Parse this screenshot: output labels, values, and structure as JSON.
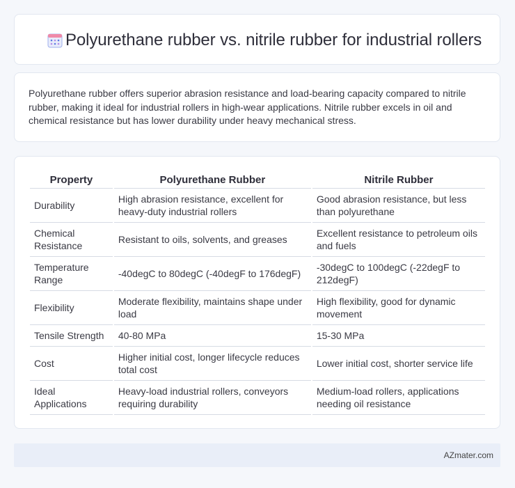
{
  "header": {
    "title": "Polyurethane rubber vs. nitrile rubber for industrial rollers",
    "icon": "calendar-icon"
  },
  "intro": {
    "text": "Polyurethane rubber offers superior abrasion resistance and load-bearing capacity compared to nitrile rubber, making it ideal for industrial rollers in high-wear applications. Nitrile rubber excels in oil and chemical resistance but has lower durability under heavy mechanical stress."
  },
  "table": {
    "headers": [
      "Property",
      "Polyurethane Rubber",
      "Nitrile Rubber"
    ],
    "rows": [
      [
        "Durability",
        "High abrasion resistance, excellent for heavy-duty industrial rollers",
        "Good abrasion resistance, but less than polyurethane"
      ],
      [
        "Chemical Resistance",
        "Resistant to oils, solvents, and greases",
        "Excellent resistance to petroleum oils and fuels"
      ],
      [
        "Temperature Range",
        "-40degC to 80degC (-40degF to 176degF)",
        "-30degC to 100degC (-22degF to 212degF)"
      ],
      [
        "Flexibility",
        "Moderate flexibility, maintains shape under load",
        "High flexibility, good for dynamic movement"
      ],
      [
        "Tensile Strength",
        "40-80 MPa",
        "15-30 MPa"
      ],
      [
        "Cost",
        "Higher initial cost, longer lifecycle reduces total cost",
        "Lower initial cost, shorter service life"
      ],
      [
        "Ideal Applications",
        "Heavy-load industrial rollers, conveyors requiring durability",
        "Medium-load rollers, applications needing oil resistance"
      ]
    ]
  },
  "footer": {
    "text": "AZmater.com"
  },
  "colors": {
    "icon_blue": "#5b7be0",
    "icon_pink": "#f08aa8",
    "icon_purple": "#b48be8"
  }
}
